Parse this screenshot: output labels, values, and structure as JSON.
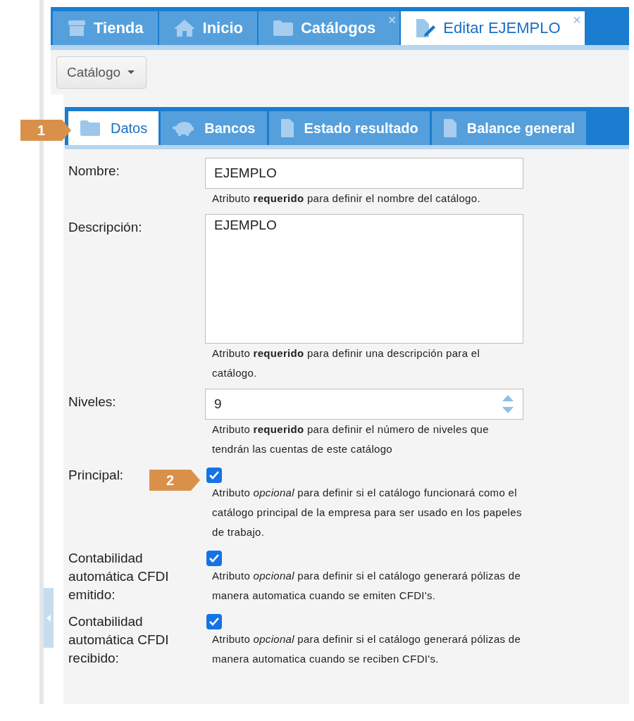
{
  "app_tabs": [
    {
      "label": "Tienda",
      "selected": false
    },
    {
      "label": "Inicio",
      "selected": false
    },
    {
      "label": "Catálogos",
      "close": "×",
      "selected": false
    },
    {
      "label": "Editar EJEMPLO",
      "close": "×",
      "selected": true
    }
  ],
  "toolbar": {
    "menu_button": "Catálogo"
  },
  "form_tabs": [
    {
      "label": "Datos",
      "selected": true
    },
    {
      "label": "Bancos",
      "selected": false
    },
    {
      "label": "Estado resultado",
      "selected": false
    },
    {
      "label": "Balance general",
      "selected": false
    }
  ],
  "fields": [
    {
      "kind": "text",
      "label": "Nombre:",
      "value": "EJEMPLO",
      "hint": "Atributo **requerido** para definir el nombre del catálogo."
    },
    {
      "kind": "textarea",
      "label": "Descripción:",
      "value": "EJEMPLO",
      "hint": "Atributo **requerido** para definir una descripción para el catálogo."
    },
    {
      "kind": "number",
      "label": "Niveles:",
      "value": "9",
      "hint": "Atributo **requerido** para definir el número de niveles que tendrán las cuentas de este catálogo"
    },
    {
      "kind": "checkbox",
      "label": "Principal:",
      "checked": true,
      "hint": "Atributo *opcional* para definir si el catálogo funcionará como el catálogo principal de la empresa para ser usado en los papeles de trabajo."
    },
    {
      "kind": "checkbox",
      "label": "Contabilidad automática CFDI emitido:",
      "checked": true,
      "hint": "Atributo *opcional* para definir si el catálogo generará pólizas de manera automatica cuando se emiten CFDI's."
    },
    {
      "kind": "checkbox",
      "label": "Contabilidad automática CFDI recibido:",
      "checked": true,
      "hint": "Atributo *opcional* para definir si el catálogo generará pólizas de manera automatica cuando se reciben CFDI's."
    }
  ],
  "annotations": [
    {
      "number": "1"
    },
    {
      "number": "2"
    }
  ]
}
